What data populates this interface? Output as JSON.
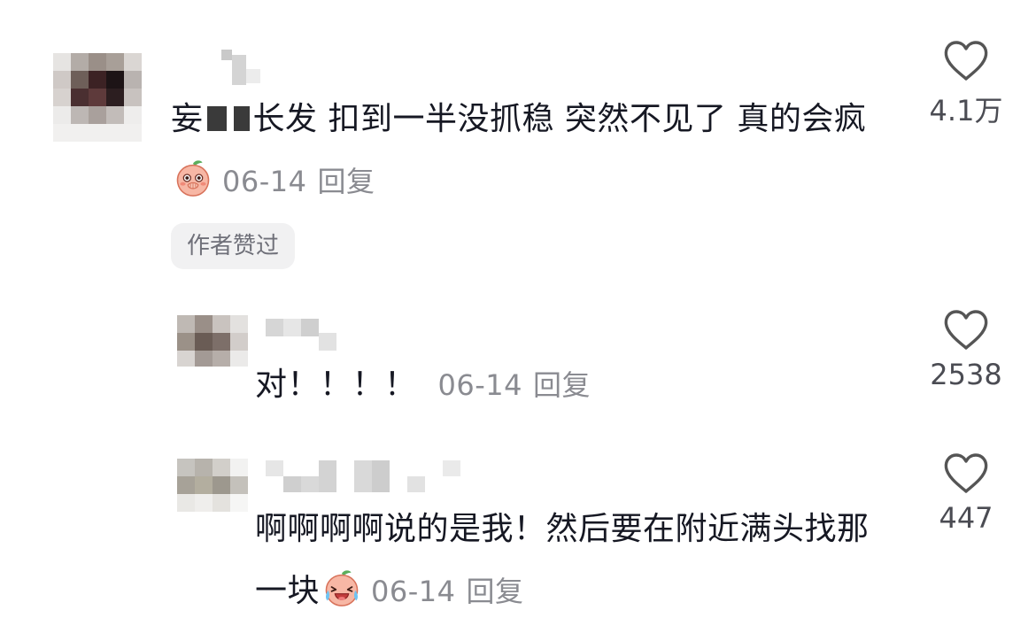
{
  "comments": [
    {
      "text_prefix": "妄",
      "text": "长发 扣到一半没抓稳 突然不见了 真的会疯",
      "date": "06-14",
      "reply_label": "回复",
      "badge": "作者赞过",
      "likes": "4.1万"
    },
    {
      "text": "对！！！！",
      "date": "06-14",
      "reply_label": "回复",
      "likes": "2538"
    },
    {
      "text": "啊啊啊啊说的是我！然后要在附近满头找那一块",
      "date": "06-14",
      "reply_label": "回复",
      "likes": "447"
    }
  ],
  "icons": {
    "like": "heart-outline-icon",
    "emoji_1": "peach-covering-mouth-emoji",
    "emoji_2": "peach-laughing-crying-emoji"
  },
  "colors": {
    "text": "#161823",
    "meta": "#8a8b91",
    "heart": "#555555",
    "badge_bg": "#f1f1f2"
  }
}
